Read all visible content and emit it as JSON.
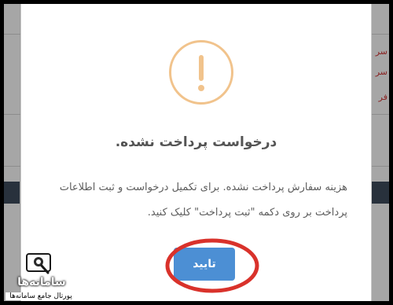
{
  "dialog": {
    "title": "درخواست پرداخت نشده.",
    "message": "هزینه سفارش پرداخت نشده. برای تکمیل درخواست و ثبت اطلاعات پرداخت بر روی دکمه \"ثبت پرداخت\" کلیک کنید.",
    "confirm_label": "تایید",
    "icon": "exclamation-circle-icon",
    "icon_color": "#f1c38c",
    "button_color": "#4c8fd4",
    "highlight_color": "#d9322b"
  },
  "background": {
    "left_fragments": [
      "...",
      "...",
      "..."
    ],
    "right_fragments": [
      "سر",
      "سر",
      "فر"
    ]
  },
  "logo": {
    "name": "سامانه‌ها",
    "tagline": "پورتال جامع سامانه‌ها"
  }
}
